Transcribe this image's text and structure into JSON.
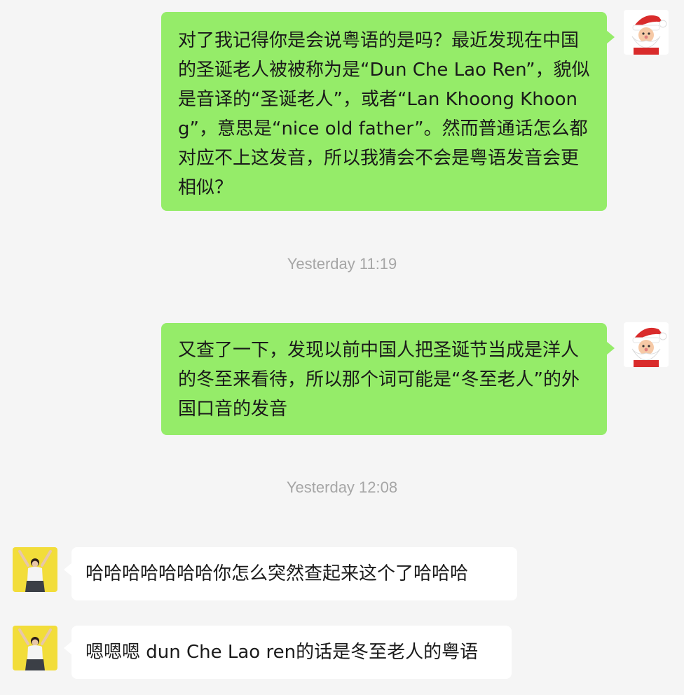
{
  "messages": [
    {
      "sender": "me",
      "text": "对了我记得你是会说粤语的是吗？最近发现在中国的圣诞老人被被称为是“Dun Che Lao Ren”，貌似是音译的“圣诞老人”，或者“Lan Khoong Khoong”，意思是“nice old father”。然而普通话怎么都对应不上这发音，所以我猜会不会是粤语发音会更相似？"
    },
    {
      "time": "Yesterday 11:19"
    },
    {
      "sender": "me",
      "text": "又查了一下，发现以前中国人把圣诞节当成是洋人的冬至来看待，所以那个词可能是“冬至老人”的外国口音的发音"
    },
    {
      "time": "Yesterday 12:08"
    },
    {
      "sender": "other",
      "text": "哈哈哈哈哈哈哈你怎么突然查起来这个了哈哈哈"
    },
    {
      "sender": "other",
      "text": "嗯嗯嗯 dun Che Lao ren的话是冬至老人的粤语"
    }
  ],
  "colors": {
    "background": "#f5f5f5",
    "outgoing_bubble": "#95ec69",
    "incoming_bubble": "#ffffff",
    "timestamp": "#a6a6a6"
  },
  "avatars": {
    "me": "santa-claus-avatar",
    "other": "person-yellow-background-avatar"
  }
}
